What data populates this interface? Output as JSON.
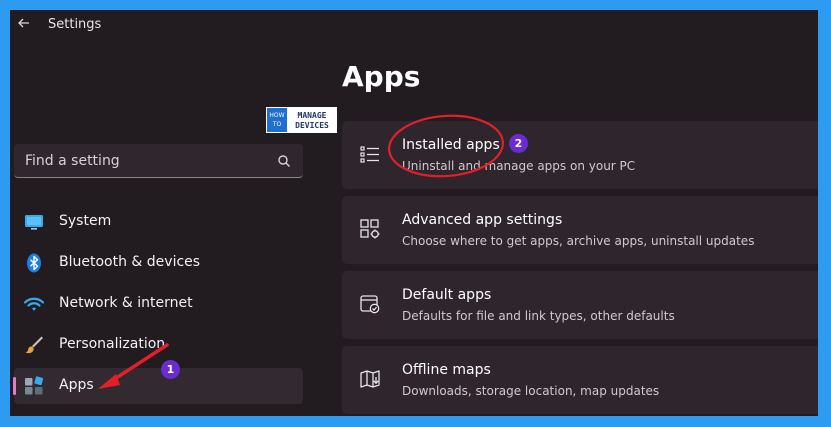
{
  "window": {
    "title": "Settings",
    "back_icon": "arrow-left-icon"
  },
  "page": {
    "title": "Apps"
  },
  "logo": {
    "line1": "HOW",
    "line2": "TO",
    "word1": "MANAGE",
    "word2": "DEVICES"
  },
  "search": {
    "placeholder": "Find a setting",
    "icon": "search-icon"
  },
  "sidebar": {
    "items": [
      {
        "label": "System",
        "icon": "monitor-icon"
      },
      {
        "label": "Bluetooth & devices",
        "icon": "bluetooth-icon"
      },
      {
        "label": "Network & internet",
        "icon": "wifi-icon"
      },
      {
        "label": "Personalization",
        "icon": "brush-icon"
      },
      {
        "label": "Apps",
        "icon": "apps-icon",
        "selected": true
      }
    ]
  },
  "cards": [
    {
      "title": "Installed apps",
      "description": "Uninstall and manage apps on your PC",
      "icon": "list-icon"
    },
    {
      "title": "Advanced app settings",
      "description": "Choose where to get apps, archive apps, uninstall updates",
      "icon": "app-settings-icon"
    },
    {
      "title": "Default apps",
      "description": "Defaults for file and link types, other defaults",
      "icon": "default-apps-icon"
    },
    {
      "title": "Offline maps",
      "description": "Downloads, storage location, map updates",
      "icon": "map-icon"
    }
  ],
  "annotations": {
    "badge1": "1",
    "badge2": "2"
  },
  "colors": {
    "background_frame": "#2d9bf0",
    "window_bg": "#221b20",
    "card_bg": "#2e262c",
    "accent_selected": "#e07bd6",
    "badge": "#6a2bd1",
    "annotation_red": "#e3202a"
  }
}
